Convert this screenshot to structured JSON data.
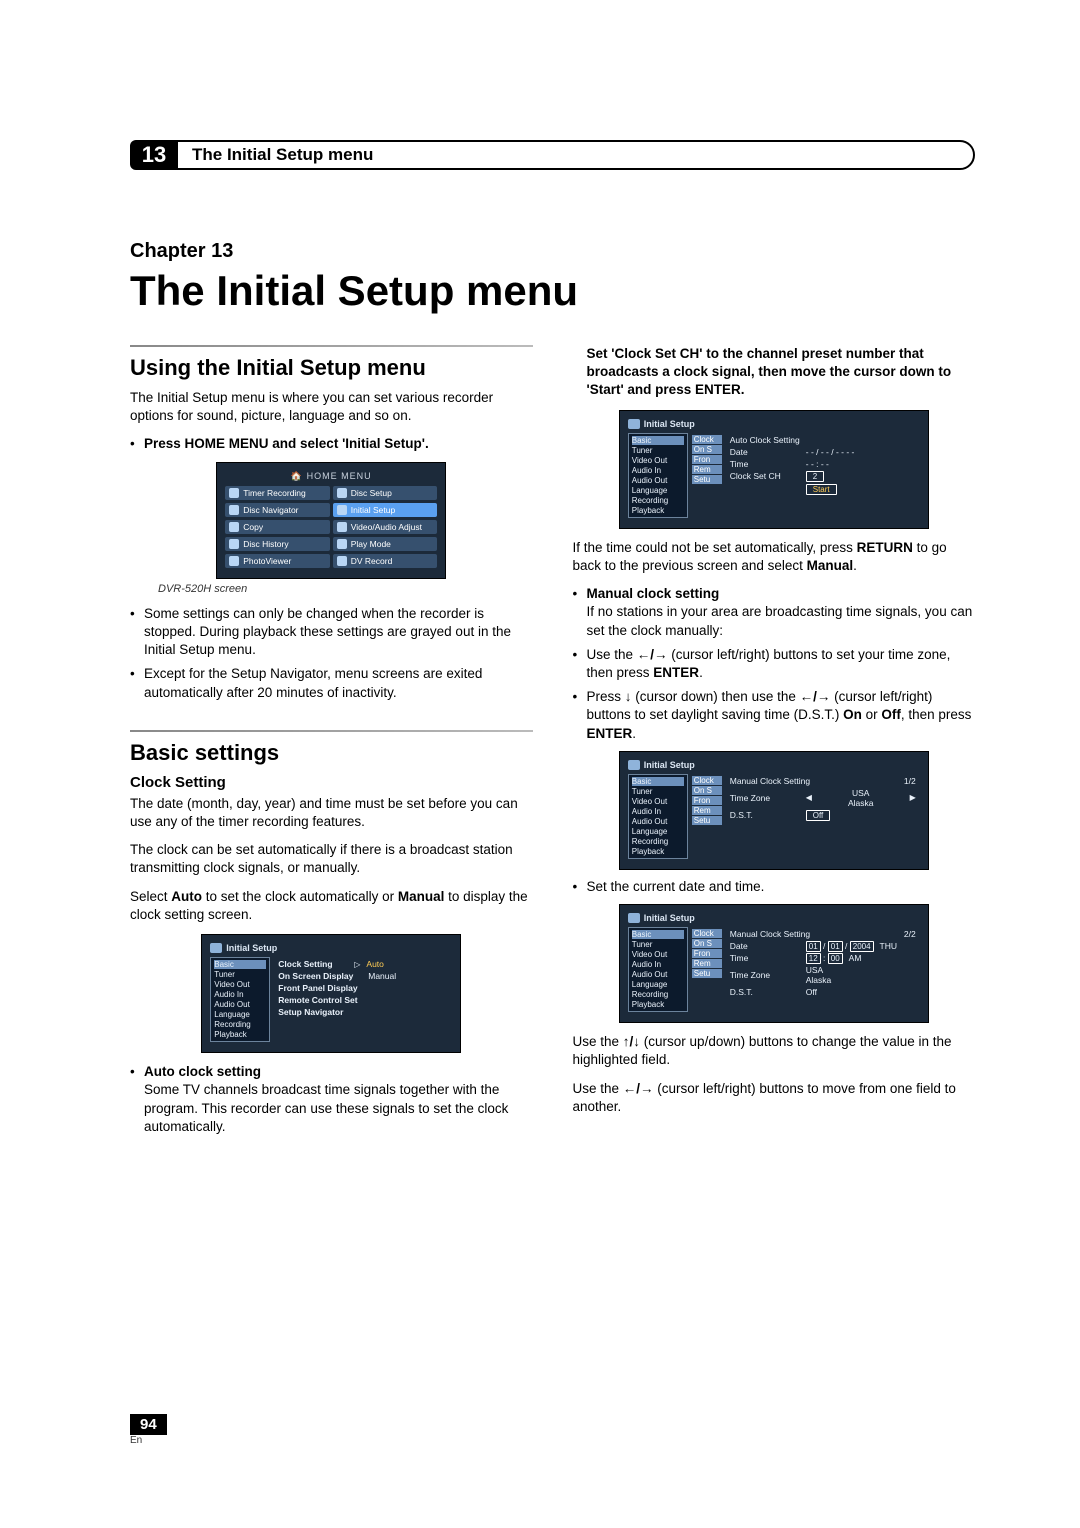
{
  "header": {
    "chapter_num": "13",
    "chapter_title": "The Initial Setup menu"
  },
  "hero": {
    "chapter_label": "Chapter 13",
    "title": "The Initial Setup menu"
  },
  "left": {
    "sec1_title": "Using the Initial Setup menu",
    "sec1_body": "The Initial Setup menu is where you can set various recorder options for sound, picture, language and so on.",
    "sec1_bullet1": "Press HOME MENU and select 'Initial Setup'.",
    "home_menu": {
      "title": "HOME MENU",
      "items": [
        "Timer Recording",
        "Disc Setup",
        "Disc Navigator",
        "Initial Setup",
        "Copy",
        "Video/Audio Adjust",
        "Disc History",
        "Play Mode",
        "PhotoViewer",
        "DV Record"
      ]
    },
    "caption1": "DVR-520H screen",
    "sec1_bullet2": "Some settings can only be changed when the recorder is stopped. During playback these settings are grayed out in the Initial Setup menu.",
    "sec1_bullet3": "Except for the Setup Navigator, menu screens are exited automatically after 20 minutes of inactivity.",
    "sec2_title": "Basic settings",
    "sec2_sub1": "Clock Setting",
    "sec2_body1": "The date (month, day, year) and time must be set before you can use any of the timer recording features.",
    "sec2_body2": "The clock can be set automatically if there is a broadcast station transmitting clock signals, or manually.",
    "sec2_body3_a": "Select ",
    "sec2_body3_b": "Auto",
    "sec2_body3_c": " to set the clock automatically or ",
    "sec2_body3_d": "Manual",
    "sec2_body3_e": " to display the clock setting screen.",
    "fig_setup1": {
      "title": "Initial Setup",
      "side": [
        "Basic",
        "Tuner",
        "Video Out",
        "Audio In",
        "Audio Out",
        "Language",
        "Recording",
        "Playback"
      ],
      "mid_labels": [
        "Clock Setting",
        "On Screen Display",
        "Front Panel Display",
        "Remote Control Set",
        "Setup Navigator"
      ],
      "opt1": "Auto",
      "opt2": "Manual"
    },
    "sec2_sub2": "Auto clock setting",
    "sec2_body4": "Some TV channels broadcast time signals together with the program. This recorder can use these signals to set the clock automatically."
  },
  "right": {
    "intro": "Set 'Clock Set CH' to the channel preset number that broadcasts a clock signal, then move the cursor down to 'Start' and press ENTER.",
    "fig_auto": {
      "title": "Initial Setup",
      "main_title": "Auto Clock Setting",
      "side": [
        "Basic",
        "Tuner",
        "Video Out",
        "Audio In",
        "Audio Out",
        "Language",
        "Recording",
        "Playback"
      ],
      "mid": [
        "Clock",
        "On S",
        "Fron",
        "Rem",
        "Setu"
      ],
      "rows": {
        "date_l": "Date",
        "date_v": "- - / - - / - - - -",
        "time_l": "Time",
        "time_v": "- - : - -",
        "ch_l": "Clock Set CH",
        "ch_v": "2",
        "start": "Start"
      }
    },
    "p1_a": "If the time could not be set automatically, press ",
    "p1_b": "RETURN",
    "p1_c": " to go back to the previous screen and select ",
    "p1_d": "Manual",
    "p1_e": ".",
    "sub1": "Manual clock setting",
    "p2": "If no stations in your area are broadcasting time signals, you can set the clock manually:",
    "b1_a": "Use the ",
    "b1_arrows": "←/→",
    "b1_b": " (cursor left/right) buttons to set your time zone, then press ",
    "b1_c": "ENTER",
    "b1_d": ".",
    "b2_a": "Press ",
    "b2_down": "↓",
    "b2_b": " (cursor down) then use the ",
    "b2_lr": "←/→",
    "b2_c": " (cursor left/right) buttons to set daylight saving time (D.S.T.) ",
    "b2_d": "On",
    "b2_e": " or ",
    "b2_f": "Off",
    "b2_g": ", then press ",
    "b2_h": "ENTER",
    "b2_i": ".",
    "fig_man1": {
      "title": "Initial Setup",
      "main_title": "Manual Clock Setting",
      "page": "1/2",
      "side": [
        "Basic",
        "Tuner",
        "Video Out",
        "Audio In",
        "Audio Out",
        "Language",
        "Recording",
        "Playback"
      ],
      "mid": [
        "Clock",
        "On S",
        "Fron",
        "Rem",
        "Setu"
      ],
      "tz_l": "Time Zone",
      "tz_v1": "USA",
      "tz_v2": "Alaska",
      "dst_l": "D.S.T.",
      "dst_v": "Off"
    },
    "b3": "Set the current date and time.",
    "fig_man2": {
      "title": "Initial Setup",
      "main_title": "Manual Clock Setting",
      "page": "2/2",
      "side": [
        "Basic",
        "Tuner",
        "Video Out",
        "Audio In",
        "Audio Out",
        "Language",
        "Recording",
        "Playback"
      ],
      "mid": [
        "Clock",
        "On S",
        "Fron",
        "Rem",
        "Setu"
      ],
      "date_l": "Date",
      "date_v": "01 / 01 / 2004",
      "date_dow": "THU",
      "time_l": "Time",
      "time_v": "12 : 00",
      "time_ap": "AM",
      "tz_l": "Time Zone",
      "tz_v1": "USA",
      "tz_v2": "Alaska",
      "dst_l": "D.S.T.",
      "dst_v": "Off"
    },
    "p3_a": "Use the ",
    "p3_ud": "↑/↓",
    "p3_b": " (cursor up/down) buttons to change the value in the highlighted field.",
    "p4_a": "Use the ",
    "p4_lr": "←/→",
    "p4_b": " (cursor left/right) buttons to move from one field to another."
  },
  "footer": {
    "page": "94",
    "lang": "En"
  }
}
